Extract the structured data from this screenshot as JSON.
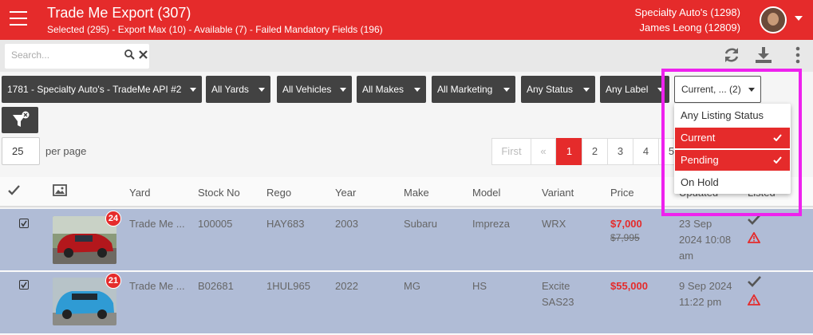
{
  "header": {
    "title": "Trade Me Export (307)",
    "subtitle": "Selected (295) - Export Max (10) - Available (7) - Failed Mandatory Fields (196)",
    "dealer": "Specialty Auto's (1298)",
    "user": "James Leong (12809)"
  },
  "toolbar": {
    "search_placeholder": "Search...",
    "icons": [
      "refresh-icon",
      "download-icon",
      "more-vert-icon"
    ]
  },
  "filters": [
    "1781 - Specialty Auto's - TradeMe API #2",
    "All Yards",
    "All Vehicles",
    "All Makes",
    "All Marketing",
    "Any Status",
    "Any Label"
  ],
  "listing_status_filter": {
    "value": "Current, ... (2)",
    "options": [
      {
        "label": "Any Listing Status",
        "selected": false
      },
      {
        "label": "Current",
        "selected": true
      },
      {
        "label": "Pending",
        "selected": true
      },
      {
        "label": "On Hold",
        "selected": false
      }
    ]
  },
  "paging": {
    "per_page": "25",
    "per_page_label": "per page",
    "first": "First",
    "prev": "«",
    "pages": [
      "1",
      "2",
      "3",
      "4",
      "5"
    ],
    "current_page": "1"
  },
  "table": {
    "columns": [
      "Yard",
      "Stock No",
      "Rego",
      "Year",
      "Make",
      "Model",
      "Variant",
      "Price",
      "Updated",
      "Listed"
    ],
    "rows": [
      {
        "photo_count": "24",
        "yard": "Trade Me ...",
        "stock_no": "100005",
        "rego": "HAY683",
        "year": "2003",
        "make": "Subaru",
        "model": "Impreza",
        "variant": "WRX",
        "variant_2": "",
        "price": "$7,000",
        "old_price": "$7,995",
        "updated_1": "23 Sep",
        "updated_2": "2024 10:08",
        "updated_3": "am"
      },
      {
        "photo_count": "21",
        "yard": "Trade Me ...",
        "stock_no": "B02681",
        "rego": "1HUL965",
        "year": "2022",
        "make": "MG",
        "model": "HS",
        "variant": "Excite",
        "variant_2": "SAS23",
        "price": "$55,000",
        "old_price": "",
        "updated_1": "9 Sep 2024",
        "updated_2": "11:22 pm",
        "updated_3": ""
      }
    ]
  },
  "colors": {
    "brand_red": "#e52b2b",
    "filter_dark": "#424242",
    "row_selected": "#b0bcd6",
    "highlight": "#ee22ee"
  }
}
